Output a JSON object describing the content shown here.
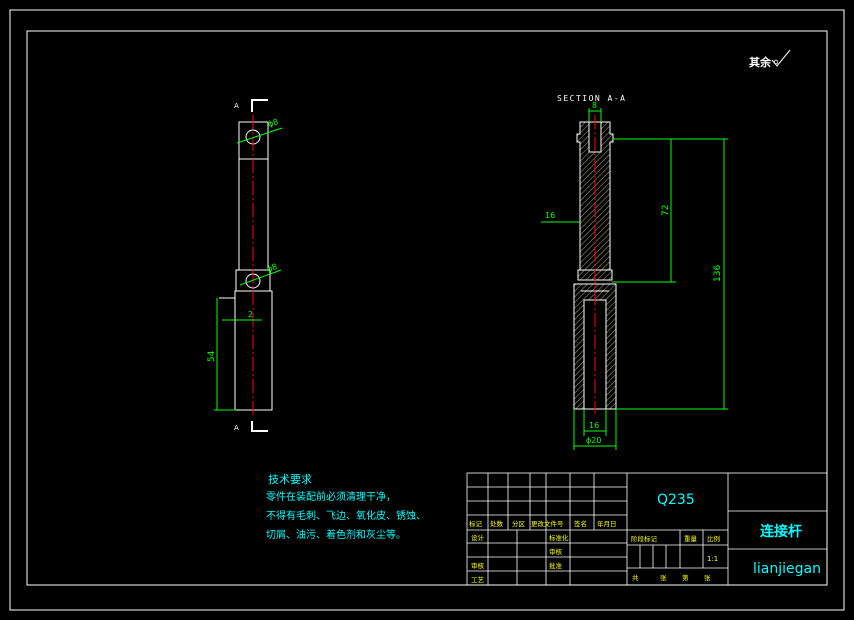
{
  "colors": {
    "background": "#000000",
    "line": "#ffffff",
    "dimension": "#00ff00",
    "centerline": "#ff0000",
    "hatch": "#d8d8a0",
    "section_text": "#ffffff",
    "note_text": "#00ffff",
    "title_text": "#00ffff",
    "table_text": "#ffff00",
    "table_line": "#ffffff"
  },
  "roughness_note": "其余",
  "front_view": {
    "section_marks": [
      "A",
      "A"
    ],
    "dims": {
      "hole_top": "ϕ8",
      "hole_bottom": "ϕ8",
      "step": "2",
      "length": "54"
    }
  },
  "section_view": {
    "title": "SECTION A-A",
    "dims": {
      "top_width": "8",
      "left_bore": "16",
      "upper_length": "72",
      "total_length": "136",
      "inner_bore": "16",
      "outer_diameter": "ϕ20"
    }
  },
  "tech_notes": {
    "heading": "技术要求",
    "lines": [
      "零件在装配前必须清理干净，",
      "不得有毛刺、飞边、氧化皮、锈蚀、",
      "切屑、油污、着色剂和灰尘等。"
    ]
  },
  "title_block": {
    "material": "Q235",
    "part_name_cn": "连接杆",
    "part_name_pinyin": "lianjiegan",
    "header_labels": [
      "标记",
      "处数",
      "分区",
      "更改文件号",
      "签名",
      "年月日"
    ],
    "row_labels": [
      "设计",
      "审核",
      "工艺"
    ],
    "mid_labels": [
      "标准化",
      "审核",
      "批准"
    ],
    "stage_labels": [
      "阶段标记",
      "重量",
      "比例"
    ],
    "scale": "1:1",
    "sheet_labels": [
      "共",
      "张",
      "第",
      "张"
    ]
  }
}
